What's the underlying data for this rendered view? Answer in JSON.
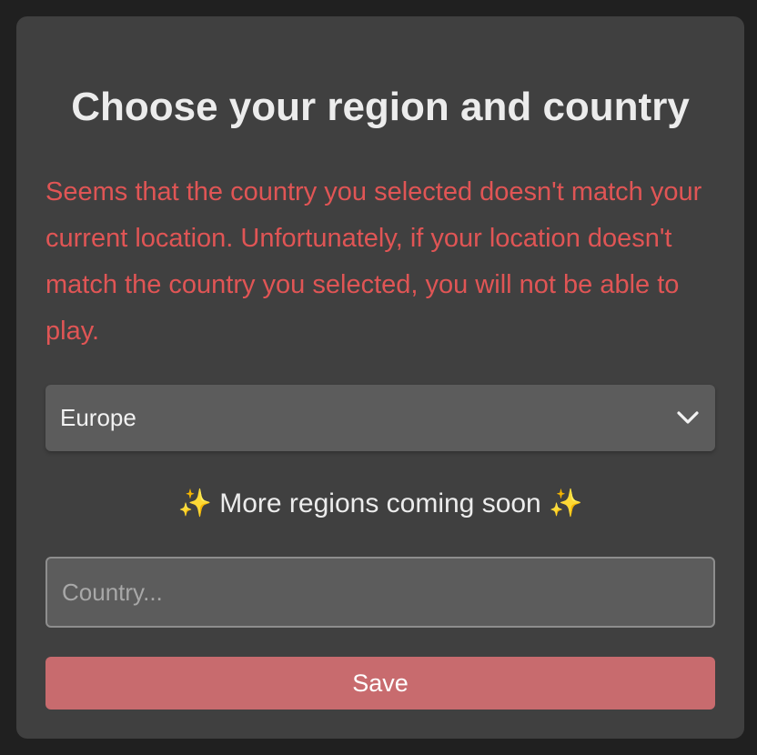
{
  "dialog": {
    "title": "Choose your region and country",
    "warning": "Seems that the country you selected doesn't match your current location. Unfortunately, if your location doesn't match the country you selected, you will not be able to play.",
    "region_select": {
      "selected": "Europe",
      "icon": "chevron-down-icon"
    },
    "note": {
      "sparkle_left": "✨",
      "text": "More regions coming soon",
      "sparkle_right": "✨"
    },
    "country_input": {
      "value": "",
      "placeholder": "Country..."
    },
    "save_label": "Save"
  },
  "colors": {
    "page_background": "#202020",
    "card_background": "#404040",
    "warning_text": "#e05555",
    "control_background": "#5c5c5c",
    "save_button": "#c86b6e"
  }
}
